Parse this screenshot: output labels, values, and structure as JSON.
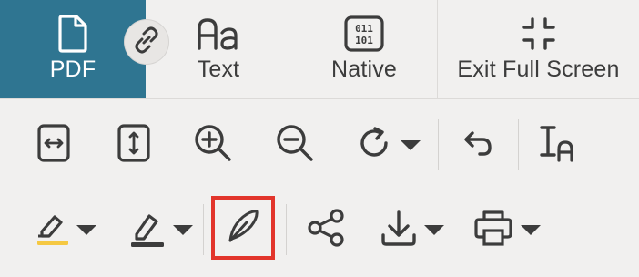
{
  "tabs": [
    {
      "label": "PDF",
      "icon": "document-icon",
      "active": true
    },
    {
      "label": "Text",
      "icon": "text-format-icon",
      "active": false
    },
    {
      "label": "Native",
      "icon": "binary-icon",
      "active": false
    },
    {
      "label": "Exit Full Screen",
      "icon": "exit-fullscreen-icon",
      "active": false
    }
  ],
  "link_badge_icon": "link-icon",
  "toolbar": {
    "row1": [
      "fit-width-icon",
      "fit-height-icon",
      "zoom-in-icon",
      "zoom-out-icon",
      "rotate-icon",
      "undo-icon",
      "text-size-icon"
    ],
    "row2": [
      "highlighter-icon",
      "pen-icon",
      "feather-sign-icon",
      "share-icon",
      "download-icon",
      "print-icon"
    ]
  },
  "colors": {
    "active_tab": "#2f7591",
    "icon": "#3c3c3c",
    "highlight_yellow": "#f5c842",
    "selection_red": "#e2352b",
    "background": "#f1f0ef"
  }
}
